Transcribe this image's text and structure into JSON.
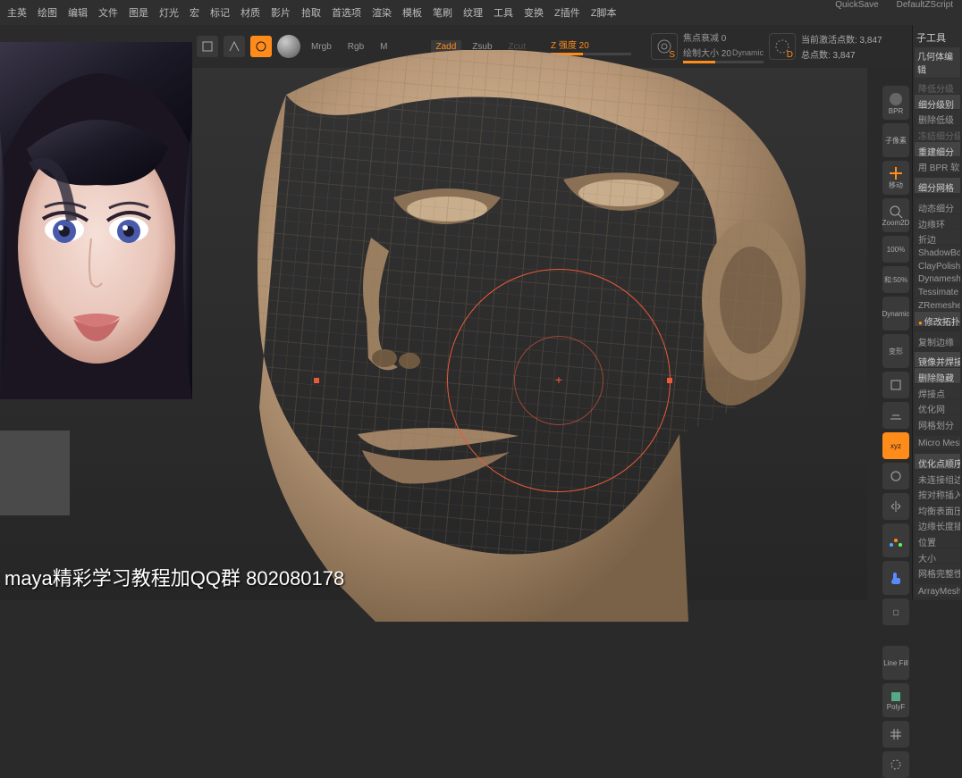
{
  "titlebar": {
    "quicksave": "QuickSave",
    "script": "DefaultZScript"
  },
  "menu": [
    "主英",
    "绘图",
    "编辑",
    "文件",
    "图是",
    "灯光",
    "宏",
    "标记",
    "材质",
    "影片",
    "拾取",
    "首选项",
    "渲染",
    "模板",
    "笔刷",
    "纹理",
    "工具",
    "变换",
    "Z插件",
    "Z脚本"
  ],
  "toolbar": {
    "modes": {
      "mrgb": "Mrgb",
      "rgb": "Rgb",
      "m": "M",
      "zadd": "Zadd",
      "zsub": "Zsub",
      "zcut": "Zcut"
    },
    "intensity": {
      "label": "Z 强度 20"
    },
    "focal": {
      "label": "焦点衰减 0"
    },
    "draw": {
      "label": "绘制大小 20",
      "dynamic": "Dynamic"
    },
    "ctrl_s": "S",
    "ctrl_d": "D",
    "stats": {
      "active": "当前激活点数: 3,847",
      "total": "总点数: 3,847"
    }
  },
  "right_tools": {
    "bpr": "BPR",
    "subtool": "子像素",
    "move": "移动",
    "zoom": "Zoom2D",
    "hundred": "100%",
    "fifty": "和:50%",
    "dynamic": "Dynamic",
    "transform": "变形",
    "lineFill": "Line Fill",
    "polyF": "PolyF",
    "xyz": "xyz"
  },
  "panel": {
    "title": "子工具",
    "geo": "几何体编辑",
    "divide_label": "细分级别",
    "remesh": "重建细分",
    "bpr_soft": "用 BPR 软",
    "sdiv": "细分网格",
    "items": [
      "动态细分",
      "边缘环",
      "折边",
      "ShadowBox",
      "ClayPolish",
      "Dynamesh",
      "Tessimate",
      "ZRemeshe"
    ],
    "modify": "修改拓扑",
    "items2": [
      "复制边缘",
      "镜像并焊接",
      "删除隐藏",
      "焊接点",
      "优化网",
      "网格划分",
      "Micro Mesh",
      "优化点顺序",
      "未连接组边",
      "按对称插入",
      "均衡表面压",
      "边缘长度插",
      "位置",
      "大小",
      "网格完整性",
      "ArrayMesh"
    ]
  },
  "watermark": "maya精彩学习教程加QQ群 802080178"
}
